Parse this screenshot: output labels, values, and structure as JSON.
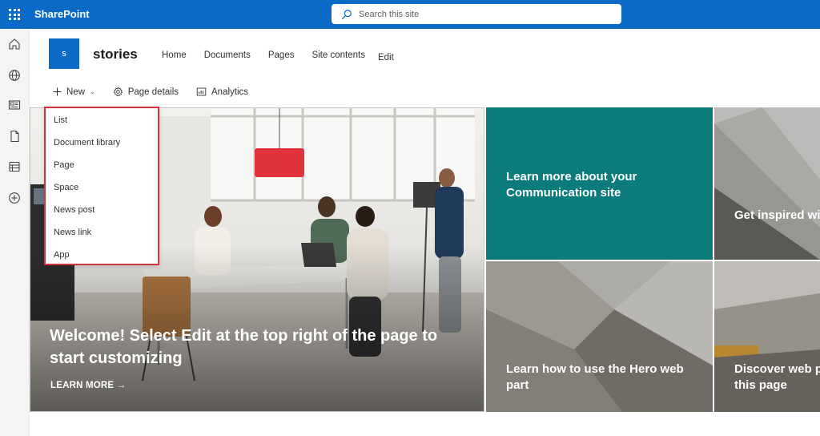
{
  "suitebar": {
    "app_name": "SharePoint",
    "search_placeholder": "Search this site"
  },
  "leftrail": {
    "icons": [
      "home-icon",
      "globe-icon",
      "news-icon",
      "file-icon",
      "lists-icon",
      "create-icon"
    ]
  },
  "site": {
    "logo_letter": "s",
    "title": "stories",
    "nav": [
      "Home",
      "Documents",
      "Pages",
      "Site contents",
      "Edit"
    ]
  },
  "commandbar": {
    "new_label": "New",
    "page_details_label": "Page details",
    "analytics_label": "Analytics"
  },
  "new_menu": {
    "items": [
      "List",
      "Document library",
      "Page",
      "Space",
      "News post",
      "News link",
      "App"
    ]
  },
  "hero": {
    "main_title": "Welcome! Select Edit at the top right of the page to start customizing",
    "learn_more": "LEARN MORE",
    "tiles": [
      "Learn more about your Communication site",
      "Get inspired with look book",
      "Learn how to use the Hero web part",
      "Discover web parts to this page"
    ]
  },
  "colors": {
    "suitebar": "#0b6ac6",
    "teal_tile": "#0b7b7c",
    "menu_border": "#d13438"
  }
}
